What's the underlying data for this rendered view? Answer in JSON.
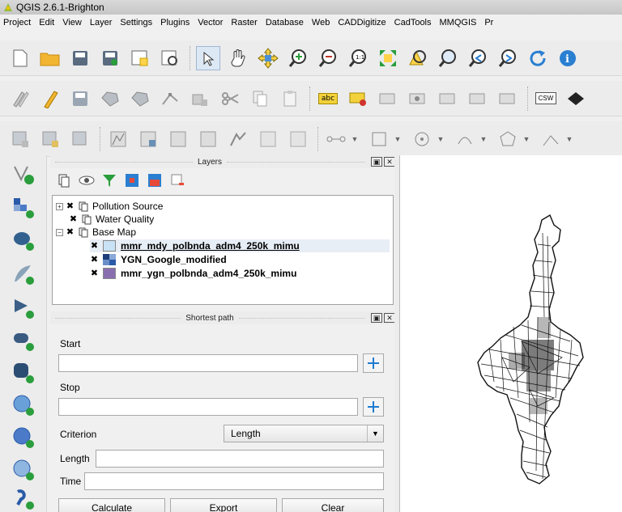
{
  "window": {
    "title": "QGIS 2.6.1-Brighton"
  },
  "menu": [
    "Project",
    "Edit",
    "View",
    "Layer",
    "Settings",
    "Plugins",
    "Vector",
    "Raster",
    "Database",
    "Web",
    "CADDigitize",
    "CadTools",
    "MMQGIS",
    "Pr"
  ],
  "layers_panel": {
    "title": "Layers",
    "items": [
      {
        "label": "Pollution Source"
      },
      {
        "label": "Water Quality"
      },
      {
        "label": "Base Map"
      },
      {
        "label": "mmr_mdy_polbnda_adm4_250k_mimu",
        "selected": true,
        "swatch": "#c9e2f5"
      },
      {
        "label": "YGN_Google_modified",
        "swatch": "raster"
      },
      {
        "label": "mmr_ygn_polbnda_adm4_250k_mimu",
        "swatch": "#8a6fb0"
      }
    ]
  },
  "shortest_path": {
    "title": "Shortest path",
    "start_label": "Start",
    "start_value": "",
    "stop_label": "Stop",
    "stop_value": "",
    "criterion_label": "Criterion",
    "criterion_value": "Length",
    "length_label": "Length",
    "length_value": "",
    "time_label": "Time",
    "time_value": "",
    "calculate_label": "Calculate",
    "export_label": "Export",
    "clear_label": "Clear"
  },
  "toolbar_extras": {
    "abc_label": "abc",
    "csw_label": "CSW"
  },
  "colors": {
    "accent": "#1f7bd1",
    "selection_bg": "#cfe3f7",
    "map_bg": "#ffffff"
  }
}
